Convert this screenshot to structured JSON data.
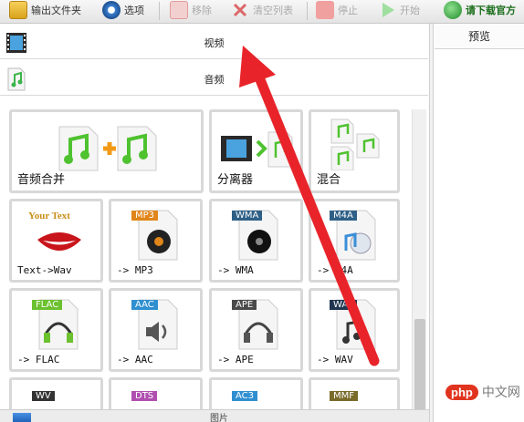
{
  "toolbar": {
    "output_folder": "输出文件夹",
    "options": "选项",
    "remove": "移除",
    "clear_list": "清空列表",
    "stop": "停止",
    "start": "开始",
    "download_official": "请下载官方"
  },
  "categories": {
    "video": "视频",
    "audio": "音频"
  },
  "preview": {
    "title": "预览"
  },
  "tiles": {
    "merge": "音频合并",
    "splitter": "分离器",
    "mix": "混合",
    "text_to_wav": "Text->Wav",
    "to_mp3": "-> MP3",
    "to_wma": "-> WMA",
    "to_m4a": "-> M4A",
    "to_flac": "-> FLAC",
    "to_aac": "-> AAC",
    "to_ape": "-> APE",
    "to_wav": "-> WAV",
    "your_text": "Your Text"
  },
  "badges": {
    "mp3": "MP3",
    "wma": "WMA",
    "m4a": "M4A",
    "flac": "FLAC",
    "aac": "AAC",
    "ape": "APE",
    "wav": "WAV",
    "wv": "WV",
    "dts": "DTS",
    "ac3": "AC3",
    "mmf": "MMF"
  },
  "colors": {
    "mp3": "#e0861a",
    "wma": "#2e5f86",
    "m4a": "#2e5f86",
    "flac": "#6cc12f",
    "aac": "#2f8fd0",
    "ape": "#4a4a4a",
    "wav": "#1f3550",
    "arrow": "#e8242a"
  },
  "bottom": {
    "label": "图片"
  },
  "watermark": {
    "badge": "php",
    "text": "中文网"
  }
}
